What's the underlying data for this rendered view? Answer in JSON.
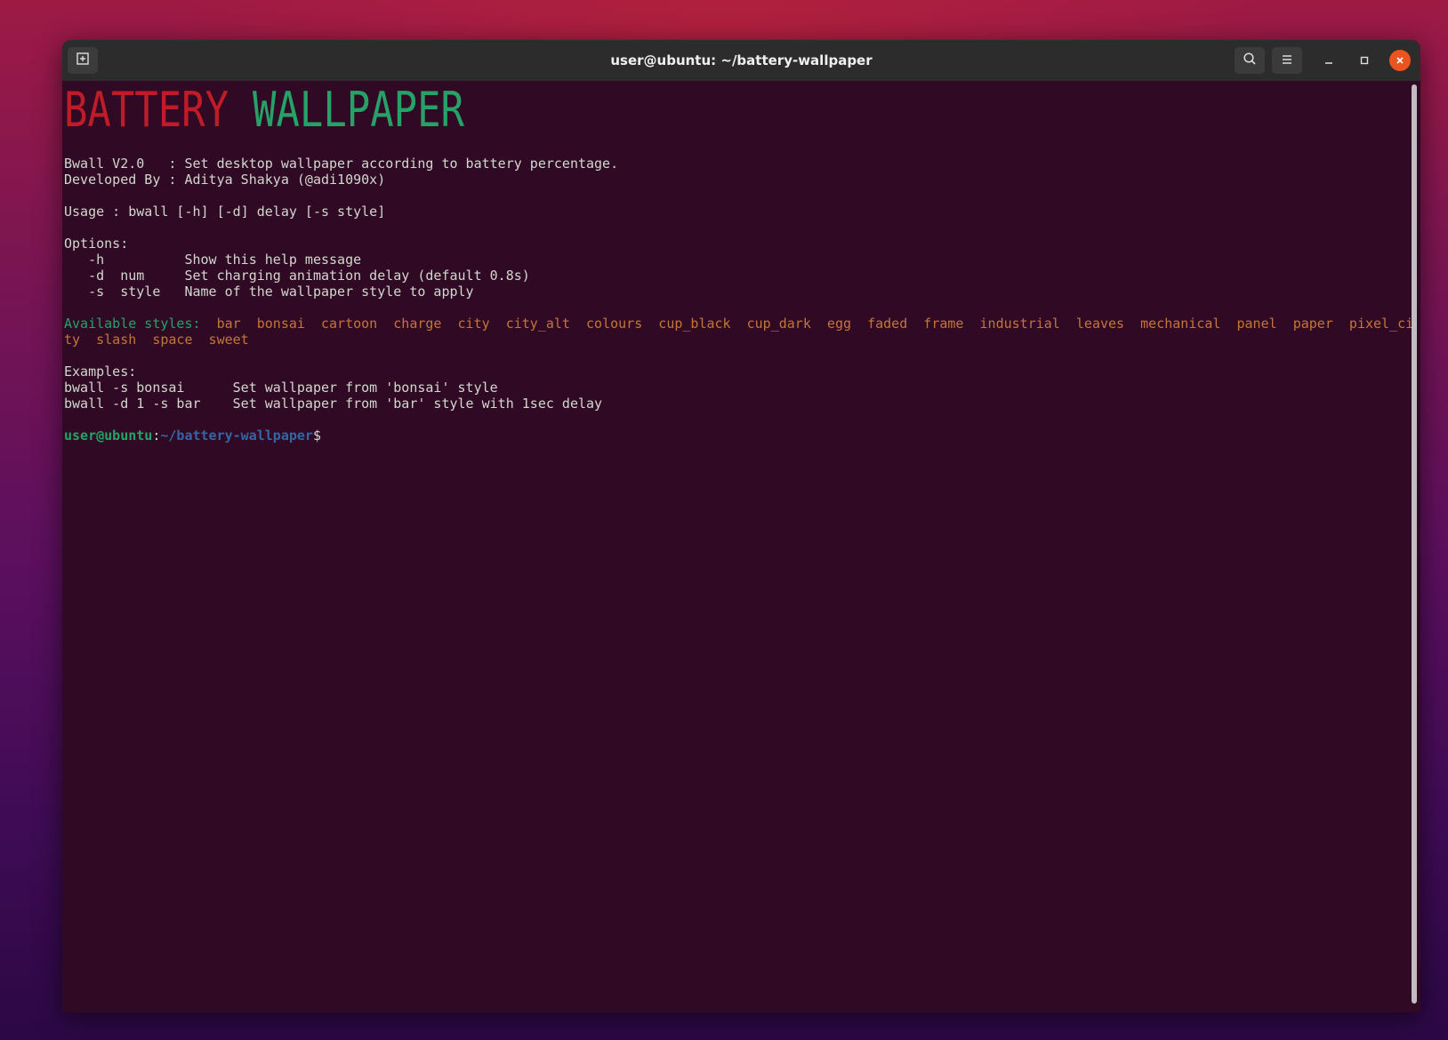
{
  "window": {
    "title": "user@ubuntu: ~/battery-wallpaper",
    "colors": {
      "accent_close": "#e95420",
      "terminal_bg": "#300a24",
      "titlebar_bg": "#2c2c2c"
    }
  },
  "icons": {
    "new_tab": "new-tab-icon",
    "search": "search-icon",
    "menu": "hamburger-menu-icon",
    "minimize": "minimize-icon",
    "maximize": "maximize-icon",
    "close": "close-icon"
  },
  "banner": {
    "word1": "BATTERY",
    "word2": "WALLPAPER",
    "colors": {
      "word1": "#c01c28",
      "word2": "#26a269"
    }
  },
  "info": {
    "line1": "Bwall V2.0   : Set desktop wallpaper according to battery percentage.",
    "line2": "Developed By : Aditya Shakya (@adi1090x)"
  },
  "usage": "Usage : bwall [-h] [-d] delay [-s style]",
  "options": {
    "header": "Options:",
    "items": [
      "   -h          Show this help message",
      "   -d  num     Set charging animation delay (default 0.8s)",
      "   -s  style   Name of the wallpaper style to apply"
    ]
  },
  "styles": {
    "label": "Available styles:",
    "line1": "  bar  bonsai  cartoon  charge  city  city_alt  colours  cup_black  cup_dark  egg  faded  frame  industrial  leaves  mechanical  panel  paper  pixel_ci",
    "line2": "ty  slash  space  sweet"
  },
  "examples": {
    "header": "Examples:",
    "items": [
      "bwall -s bonsai      Set wallpaper from 'bonsai' style",
      "bwall -d 1 -s bar    Set wallpaper from 'bar' style with 1sec delay"
    ]
  },
  "prompt": {
    "user_host": "user@ubuntu",
    "colon": ":",
    "path": "~/battery-wallpaper",
    "symbol": "$"
  }
}
